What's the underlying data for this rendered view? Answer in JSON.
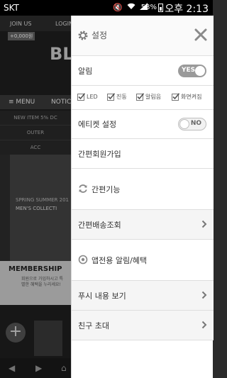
{
  "status_bar": {
    "carrier": "SKT",
    "battery": "53%",
    "time": "오후 2:13"
  },
  "background_app": {
    "join_label": "JOIN US",
    "login_label": "LOGIN",
    "price_badge": "+0,000원",
    "logo_text": "BL",
    "menu_label": "≡ MENU",
    "notice_label": "NOTIC",
    "categories": [
      "NEW ITEM 5% DC",
      "OUTER",
      "ACC"
    ],
    "banner_line1": "SPRING SUMMER 201",
    "banner_line2": "MEN'S COLLECTI",
    "membership_title": "MEMBERSHIP",
    "membership_sub": "회원으로 가입하시고 특별한 혜택을 누리세요!"
  },
  "drawer": {
    "header_title": "설정",
    "notification": {
      "label": "알림",
      "toggle_label": "YES",
      "options": [
        {
          "label": "LED",
          "checked": true
        },
        {
          "label": "진동",
          "checked": true
        },
        {
          "label": "알림음",
          "checked": true
        },
        {
          "label": "화면켜짐",
          "checked": true
        }
      ]
    },
    "etiquette": {
      "label": "에티켓 설정",
      "toggle_label": "NO"
    },
    "simple_signup": "간편회원가입",
    "simple_feature": "간편기능",
    "simple_delivery": "간편배송조회",
    "app_alert": "앱전용 알림/혜택",
    "push_view": "푸시 내용 보기",
    "invite_friend": "친구 초대"
  }
}
